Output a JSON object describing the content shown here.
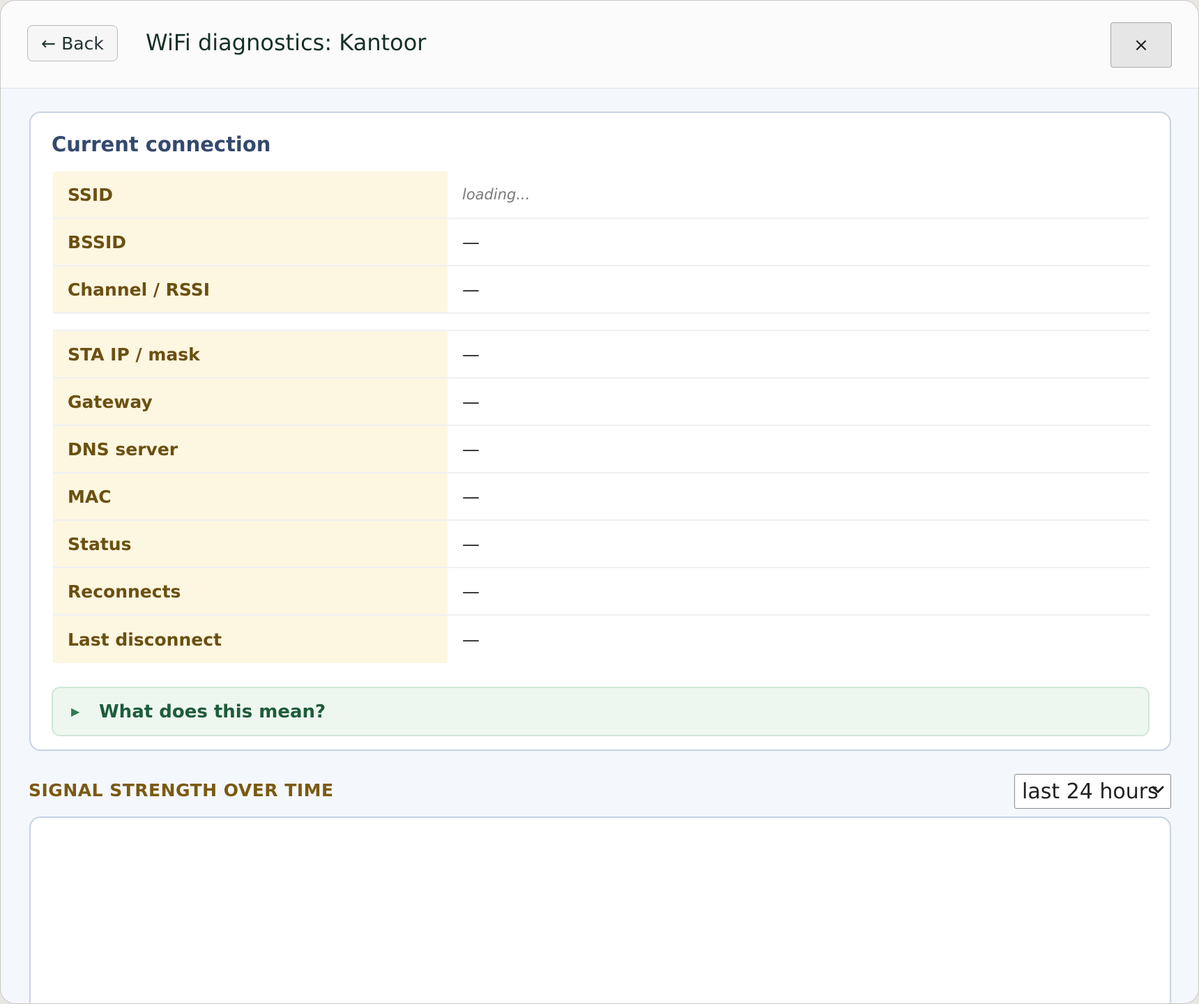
{
  "header": {
    "back_label": "Back",
    "back_arrow": "←",
    "title": "WiFi diagnostics: Kantoor",
    "close_label": "×"
  },
  "current_connection": {
    "title": "Current connection",
    "group1": [
      {
        "label": "SSID",
        "value": "loading..."
      },
      {
        "label": "BSSID",
        "value": "—"
      },
      {
        "label": "Channel / RSSI",
        "value": "—"
      }
    ],
    "group2": [
      {
        "label": "STA IP / mask",
        "value": "—"
      },
      {
        "label": "Gateway",
        "value": "—"
      },
      {
        "label": "DNS server",
        "value": "—"
      },
      {
        "label": "MAC",
        "value": "—"
      },
      {
        "label": "Status",
        "value": "—"
      },
      {
        "label": "Reconnects",
        "value": "—"
      },
      {
        "label": "Last disconnect",
        "value": "—"
      }
    ],
    "explain": {
      "icon": "disclosure-triangle-icon",
      "label": "What does this mean?"
    }
  },
  "signal": {
    "title": "SIGNAL STRENGTH OVER TIME",
    "range_selected": "last 24 hours"
  },
  "colors": {
    "label_bg": "#fdf6e1",
    "label_text": "#6b5011",
    "card_title": "#34496d",
    "explain_bg": "#edf7ef",
    "explain_text": "#1d5c3a",
    "section_title": "#7a5a10"
  }
}
